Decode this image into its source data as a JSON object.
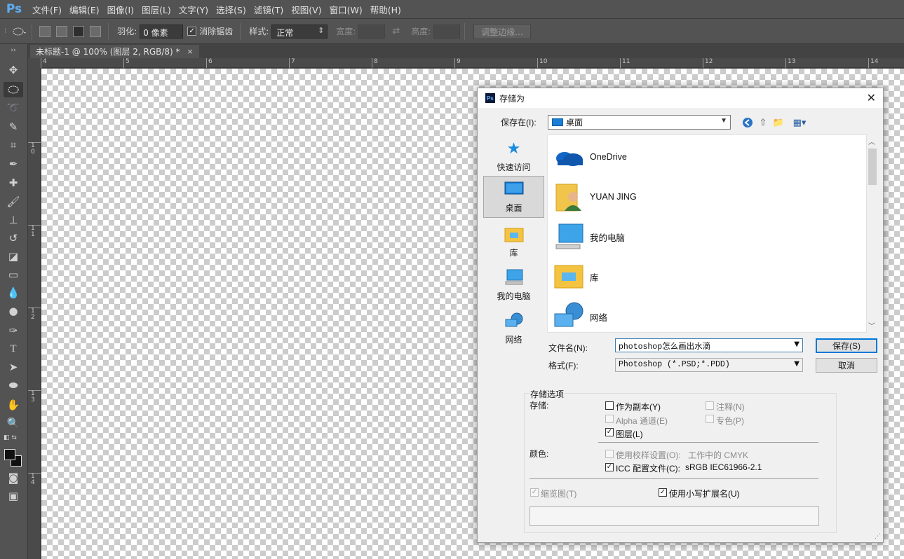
{
  "app": {
    "logo": "Ps"
  },
  "menu": [
    "文件(F)",
    "编辑(E)",
    "图像(I)",
    "图层(L)",
    "文字(Y)",
    "选择(S)",
    "滤镜(T)",
    "视图(V)",
    "窗口(W)",
    "帮助(H)"
  ],
  "options": {
    "feather_label": "羽化:",
    "feather_value": "0 像素",
    "antialias_label": "消除锯齿",
    "antialias_checked": true,
    "style_label": "样式:",
    "style_value": "正常",
    "width_label": "宽度:",
    "height_label": "高度:",
    "refine_edge_label": "调整边缘..."
  },
  "document": {
    "tab_title": "未标题-1 @ 100% (图层 2, RGB/8) *",
    "close_glyph": "×"
  },
  "rulers": {
    "horizontal": [
      "4",
      "5",
      "6",
      "7",
      "8",
      "9",
      "10",
      "11",
      "12",
      "13",
      "14"
    ],
    "vertical": [
      "1\n0",
      "1\n1",
      "1\n2",
      "1\n3",
      "1\n4"
    ]
  },
  "dialog": {
    "title": "存储为",
    "close_glyph": "✕",
    "save_in_label": "保存在(I):",
    "save_in_value": "桌面",
    "places": [
      {
        "label": "快速访问",
        "icon": "star-icon",
        "active": false
      },
      {
        "label": "桌面",
        "icon": "desktop-icon",
        "active": true
      },
      {
        "label": "库",
        "icon": "library-icon",
        "active": false
      },
      {
        "label": "我的电脑",
        "icon": "computer-icon",
        "active": false
      },
      {
        "label": "网络",
        "icon": "network-icon",
        "active": false
      }
    ],
    "files": [
      {
        "name": "OneDrive",
        "icon": "onedrive-icon"
      },
      {
        "name": "YUAN JING",
        "icon": "user-folder-icon"
      },
      {
        "name": "我的电脑",
        "icon": "computer-icon"
      },
      {
        "name": "库",
        "icon": "library-icon"
      },
      {
        "name": "网络",
        "icon": "network-icon"
      }
    ],
    "filename_label": "文件名(N):",
    "filename_value": "photoshop怎么画出水滴",
    "format_label": "格式(F):",
    "format_value": "Photoshop (*.PSD;*.PDD)",
    "save_button": "保存(S)",
    "cancel_button": "取消",
    "save_options_title": "存储选项",
    "store_label": "存储:",
    "color_label": "颜色:",
    "options": {
      "as_copy": {
        "label": "作为副本(Y)",
        "checked": false,
        "enabled": true
      },
      "notes": {
        "label": "注释(N)",
        "checked": false,
        "enabled": false
      },
      "alpha": {
        "label": "Alpha 通道(E)",
        "checked": false,
        "enabled": false
      },
      "spot": {
        "label": "专色(P)",
        "checked": false,
        "enabled": false
      },
      "layers": {
        "label": "图层(L)",
        "checked": true,
        "enabled": true
      },
      "proof": {
        "label": "使用校样设置(O):",
        "checked": false,
        "enabled": false,
        "extra": "工作中的 CMYK"
      },
      "icc": {
        "label": "ICC 配置文件(C):",
        "checked": true,
        "enabled": true,
        "extra": "sRGB IEC61966-2.1"
      },
      "thumbnail": {
        "label": "缩览图(T)",
        "checked": true,
        "enabled": false
      },
      "lowercase_ext": {
        "label": "使用小写扩展名(U)",
        "checked": true,
        "enabled": true
      }
    }
  },
  "colors": {
    "ps_blue": "#5dacf2",
    "panel_gray": "#535353",
    "dialog_bg": "#f0f0f0",
    "accent_blue": "#0078d7"
  }
}
